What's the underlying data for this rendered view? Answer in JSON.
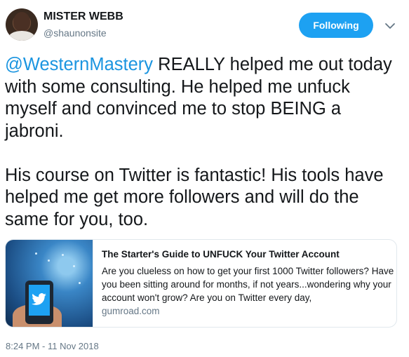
{
  "author": {
    "name": "MISTER WEBB",
    "handle": "@shaunonsite"
  },
  "follow_button": {
    "label": "Following"
  },
  "menu": {
    "icon": "chevron-down-icon"
  },
  "tweet": {
    "mention": "@WesternMastery",
    "paragraph1_rest": " REALLY helped me out today with some consulting. He helped me unfuck myself and convinced me to stop BEING a jabroni.",
    "paragraph2": "His course on Twitter is fantastic! His tools have helped me get more followers and will do the same for you, too."
  },
  "card": {
    "title": "The Starter's Guide to UNFUCK Your Twitter Account",
    "description": "Are you clueless on how to get your first 1000 Twitter followers? Have you been sitting around for months, if not years...wondering why your account won't grow? Are you on Twitter every day,",
    "domain": "gumroad.com",
    "image_icon": "twitter-bird-icon"
  },
  "timestamp": "8:24 PM - 11 Nov 2018",
  "colors": {
    "accent": "#1da1f2",
    "mention": "#1b95e0",
    "muted": "#657786",
    "border": "#e1e8ed"
  }
}
